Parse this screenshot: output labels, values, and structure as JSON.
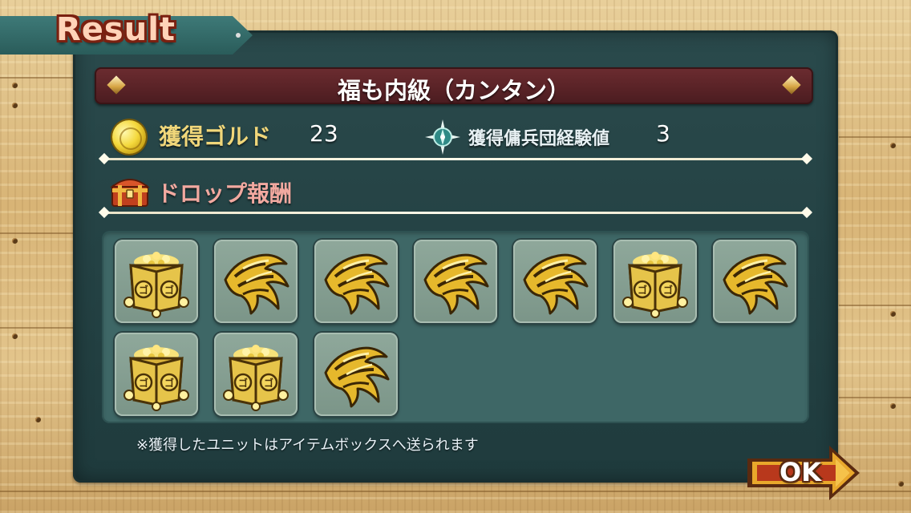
{
  "screen": {
    "title": "Result",
    "stage_name": "福も内級（カンタン）",
    "gold_label": "獲得ゴルド",
    "gold_value": "23",
    "exp_label": "獲得傭兵団経験値",
    "exp_value": "3",
    "drop_label": "ドロップ報酬",
    "note": "※獲得したユニットはアイテムボックスへ送られます",
    "ok_label": "OK"
  },
  "drops": [
    {
      "item": "gold-box"
    },
    {
      "item": "golden-claw"
    },
    {
      "item": "golden-claw"
    },
    {
      "item": "golden-claw"
    },
    {
      "item": "golden-claw"
    },
    {
      "item": "gold-box"
    },
    {
      "item": "golden-claw"
    },
    {
      "item": "gold-box"
    },
    {
      "item": "gold-box"
    },
    {
      "item": "golden-claw"
    }
  ],
  "colors": {
    "board": "#244244",
    "stage_bar": "#5a2327",
    "gold_label": "#f1d77a",
    "drop_label": "#f2a9a0",
    "slot": "#8fa89b",
    "banner": "#2a5c5a"
  }
}
